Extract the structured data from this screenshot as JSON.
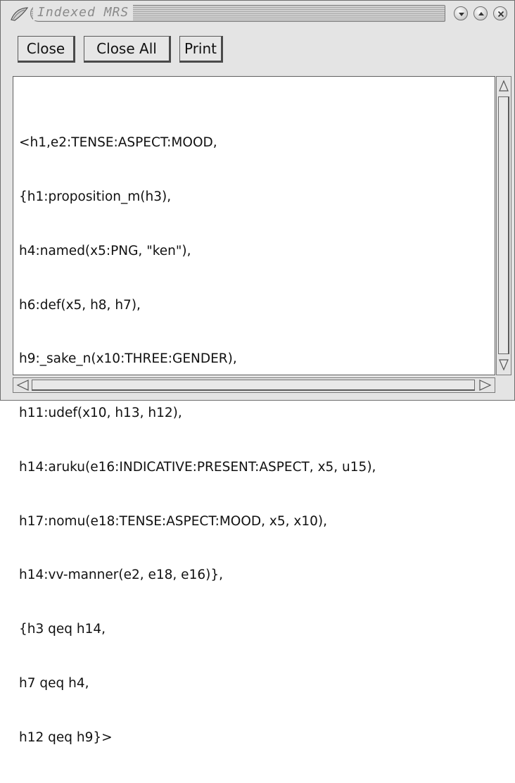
{
  "window": {
    "title": "Indexed MRS"
  },
  "toolbar": {
    "close_label": "Close",
    "close_all_label": "Close All",
    "print_label": "Print"
  },
  "mrs_text": {
    "lines": [
      "<h1,e2:TENSE:ASPECT:MOOD,",
      "{h1:proposition_m(h3),",
      "h4:named(x5:PNG, \"ken\"),",
      "h6:def(x5, h8, h7),",
      "h9:_sake_n(x10:THREE:GENDER),",
      "h11:udef(x10, h13, h12),",
      "h14:aruku(e16:INDICATIVE:PRESENT:ASPECT, x5, u15),",
      "h17:nomu(e18:TENSE:ASPECT:MOOD, x5, x10),",
      "h14:vv-manner(e2, e18, e16)},",
      "{h3 qeq h14,",
      "h7 qeq h4,",
      "h12 qeq h9}>"
    ]
  },
  "icons": {
    "title_logo": "window-logo-icon",
    "shade": "shade-icon",
    "maximize": "maximize-icon",
    "close": "close-window-icon",
    "scroll_up": "scroll-up-arrow-icon",
    "scroll_down": "scroll-down-arrow-icon",
    "scroll_left": "scroll-left-arrow-icon",
    "scroll_right": "scroll-right-arrow-icon"
  }
}
